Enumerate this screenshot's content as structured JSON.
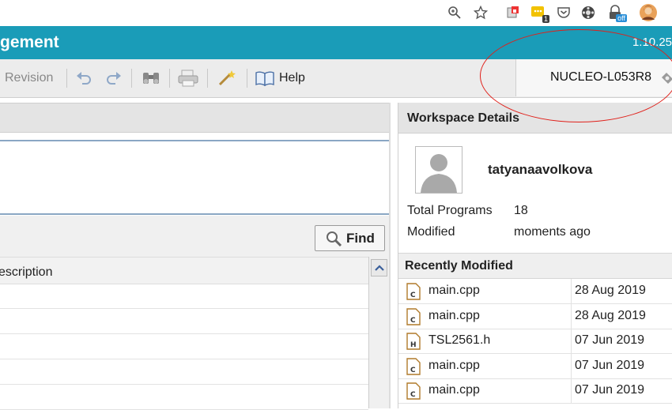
{
  "browser": {
    "icons": [
      "zoom-icon",
      "star-icon",
      "extension-puzzle-icon",
      "extension-badge-icon",
      "pocket-icon",
      "film-icon",
      "lock-off-icon",
      "profile-avatar-icon"
    ],
    "badge_count": "1",
    "off_badge": "off"
  },
  "app": {
    "title": "gement",
    "version": "1.10.25"
  },
  "toolbar": {
    "revision_label": "Revision",
    "help_label": "Help",
    "platform_label": "NUCLEO-L053R8"
  },
  "left": {
    "find_label": "Find",
    "column_description": "escription"
  },
  "workspace": {
    "title": "Workspace Details",
    "username": "tatyanaavolkova",
    "stats": [
      {
        "label": "Total Programs",
        "value": "18"
      },
      {
        "label": "Modified",
        "value": "moments ago"
      }
    ],
    "recent_title": "Recently Modified",
    "recent": [
      {
        "name": "main.cpp",
        "date": "28 Aug 2019",
        "type": "C"
      },
      {
        "name": "main.cpp",
        "date": "28 Aug 2019",
        "type": "C"
      },
      {
        "name": "TSL2561.h",
        "date": "07 Jun 2019",
        "type": "H"
      },
      {
        "name": "main.cpp",
        "date": "07 Jun 2019",
        "type": "C"
      },
      {
        "name": "main.cpp",
        "date": "07 Jun 2019",
        "type": "C"
      }
    ]
  },
  "colors": {
    "header_teal": "#1a9cb8",
    "annotation_red": "#e0201a"
  }
}
